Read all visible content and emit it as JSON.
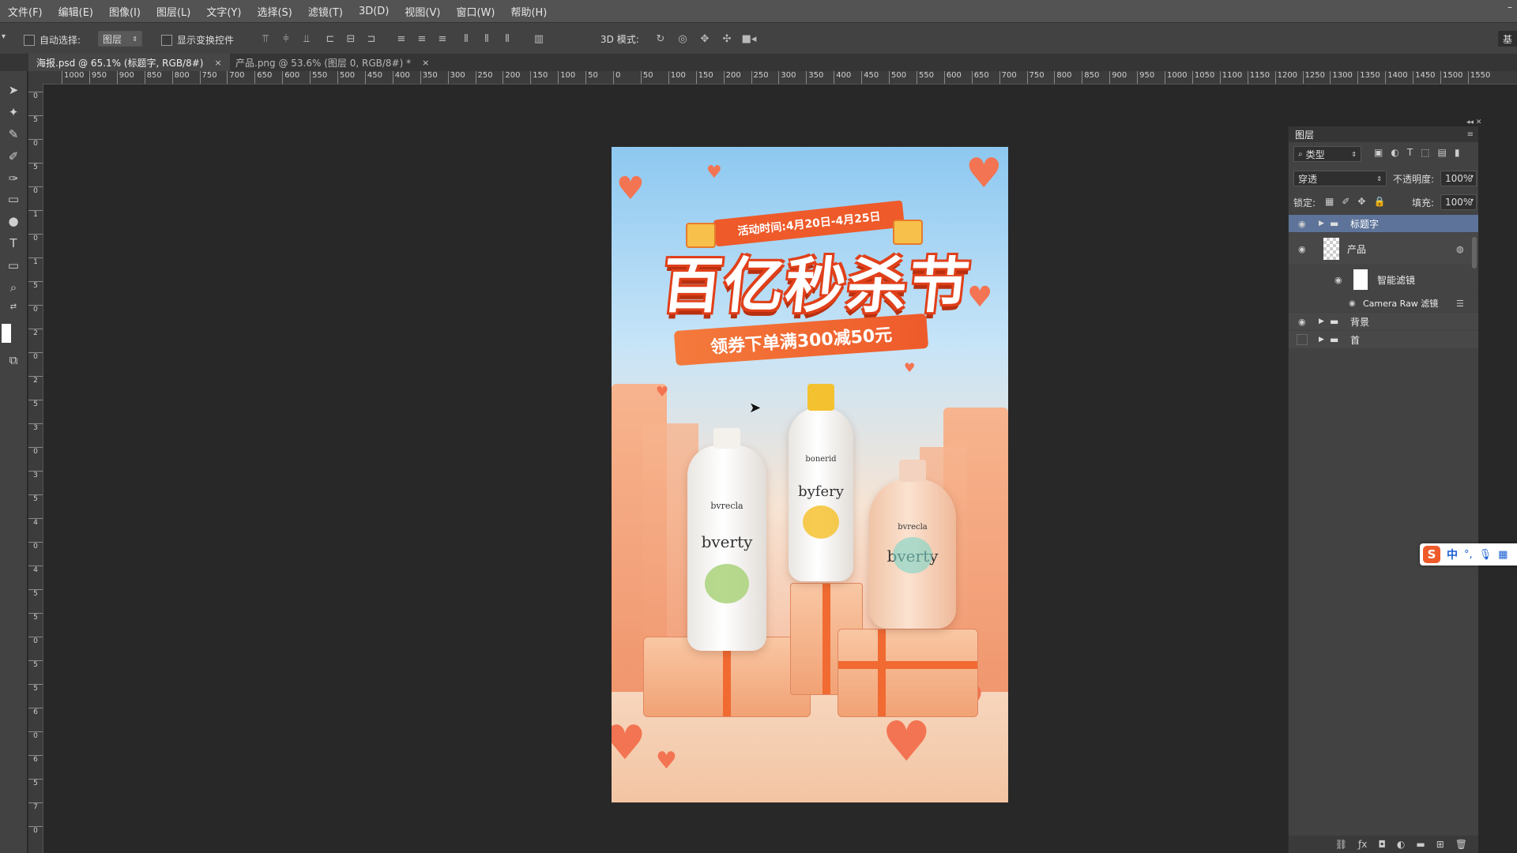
{
  "menu": [
    "文件(F)",
    "编辑(E)",
    "图像(I)",
    "图层(L)",
    "文字(Y)",
    "选择(S)",
    "滤镜(T)",
    "3D(D)",
    "视图(V)",
    "窗口(W)",
    "帮助(H)"
  ],
  "options": {
    "auto_select_label": "自动选择:",
    "auto_select_value": "图层",
    "show_transform_label": "显示变换控件",
    "mode3d_label": "3D 模式:",
    "workspace_label": "基"
  },
  "tabs": [
    {
      "label": "海报.psd @ 65.1% (标题字, RGB/8#)",
      "close": "×"
    },
    {
      "label": "产品.png @ 53.6% (图层 0, RGB/8#) *",
      "close": "×"
    }
  ],
  "ruler": {
    "h_labels": [
      "1000",
      "950",
      "900",
      "850",
      "800",
      "750",
      "700",
      "650",
      "600",
      "550",
      "500",
      "450",
      "400",
      "350",
      "300",
      "250",
      "200",
      "150",
      "100",
      "50",
      "0",
      "50",
      "100",
      "150",
      "200",
      "250",
      "300",
      "350",
      "400",
      "450",
      "500",
      "550",
      "600",
      "650",
      "700",
      "750",
      "800",
      "850",
      "900",
      "950",
      "1000",
      "1050",
      "1100",
      "1150",
      "1200",
      "1250",
      "1300",
      "1350",
      "1400",
      "1450",
      "1500",
      "1550"
    ],
    "v_labels": [
      "0",
      "5",
      "0",
      "5",
      "0",
      "1",
      "0",
      "1",
      "5",
      "0",
      "2",
      "0",
      "2",
      "5",
      "3",
      "0",
      "3",
      "5",
      "4",
      "0",
      "4",
      "5",
      "5",
      "0",
      "5",
      "5",
      "6",
      "0",
      "6",
      "5",
      "7",
      "0"
    ]
  },
  "poster": {
    "date_text": "活动时间:4月20日-4月25日",
    "title": "百亿秒杀节",
    "subtitle": "领券下单满300减50元",
    "bottles": [
      {
        "small": "bvrecla",
        "brand": "bverty"
      },
      {
        "small": "bonerid",
        "brand": "byfery"
      },
      {
        "small": "bvrecla",
        "brand": "bverty"
      }
    ]
  },
  "layers_panel": {
    "title": "图层",
    "filter_kind": "类型",
    "blend_mode": "穿透",
    "opacity_label": "不透明度:",
    "opacity_value": "100%",
    "lock_label": "锁定:",
    "fill_label": "填充:",
    "fill_value": "100%",
    "layers": [
      {
        "name": "标题字",
        "type": "group",
        "visible": true,
        "selected": true
      },
      {
        "name": "产品",
        "type": "smart-object",
        "visible": true
      },
      {
        "name": "智能滤镜",
        "type": "filter-mask",
        "visible": true
      },
      {
        "name": "Camera Raw 滤镜",
        "type": "filter",
        "visible": true
      },
      {
        "name": "背景",
        "type": "group",
        "visible": true
      },
      {
        "name": "首",
        "type": "group",
        "visible": false
      }
    ]
  },
  "ime": {
    "lang": "中"
  },
  "colors": {
    "accent": "#f06a32",
    "selected_layer": "#5d7399",
    "panel_bg": "#424242",
    "workspace_bg": "#282828"
  }
}
